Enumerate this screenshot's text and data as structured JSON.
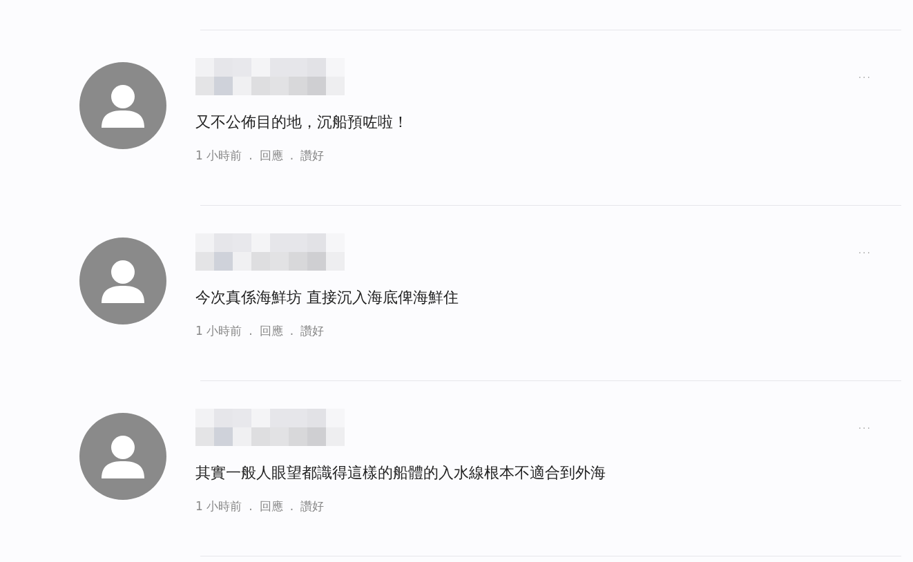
{
  "comments": [
    {
      "text": "又不公佈目的地，沉船預咗啦！",
      "time": "1 小時前",
      "sep1": ".",
      "reply": "回應",
      "sep2": ".",
      "like": "讚好",
      "more": "···"
    },
    {
      "text": "今次真係海鮮坊 直接沉入海底俾海鮮住",
      "time": "1 小時前",
      "sep1": ".",
      "reply": "回應",
      "sep2": ".",
      "like": "讚好",
      "more": "···"
    },
    {
      "text": "其實一般人眼望都識得這樣的船體的入水線根本不適合到外海",
      "time": "1 小時前",
      "sep1": ".",
      "reply": "回應",
      "sep2": ".",
      "like": "讚好",
      "more": "···"
    }
  ]
}
